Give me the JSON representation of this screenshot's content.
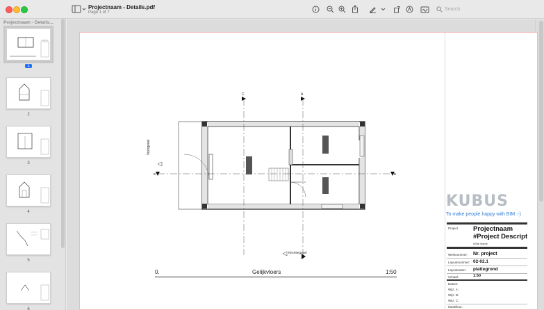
{
  "window": {
    "title": "Projectnaam - Details.pdf",
    "subtitle": "Page 1 of 7"
  },
  "search": {
    "placeholder": "Search"
  },
  "sidebar": {
    "title": "Projectnaam - Details....",
    "pages": [
      "1",
      "2",
      "3",
      "4",
      "5",
      "6"
    ],
    "selected": "1"
  },
  "drawing": {
    "floor_name": "Gelijkvloers",
    "floor_level": "0.",
    "scale": "1:50",
    "section_marks": [
      "C",
      "A",
      "B",
      "B"
    ],
    "left_label": "Voorgevel",
    "bottom_label": "Rechtergevel"
  },
  "titleblock": {
    "brand": "KUBUS",
    "tagline": "To make people happy with BIM :-)",
    "project_label": "Project",
    "project_name": "Projectnaam",
    "project_desc": "#Project Description",
    "site_name": "#Site Name",
    "werknummer_label": "Werknummer:",
    "werknummer": "Nr. project",
    "layoutnummer_label": "Layoutnummer:",
    "layoutnummer": "02-02.1",
    "layoutnaam_label": "Layoutnaam:",
    "layoutnaam": "plattegrond",
    "schaal_label": "Schaal:",
    "schaal": "1:50",
    "datum_label": "Datum:",
    "wijz_a": "Wijz. A:",
    "wijz_b": "Wijz. B:",
    "wijz_c": "Wijz. C:",
    "modelleur_label": "Modelleur:"
  }
}
